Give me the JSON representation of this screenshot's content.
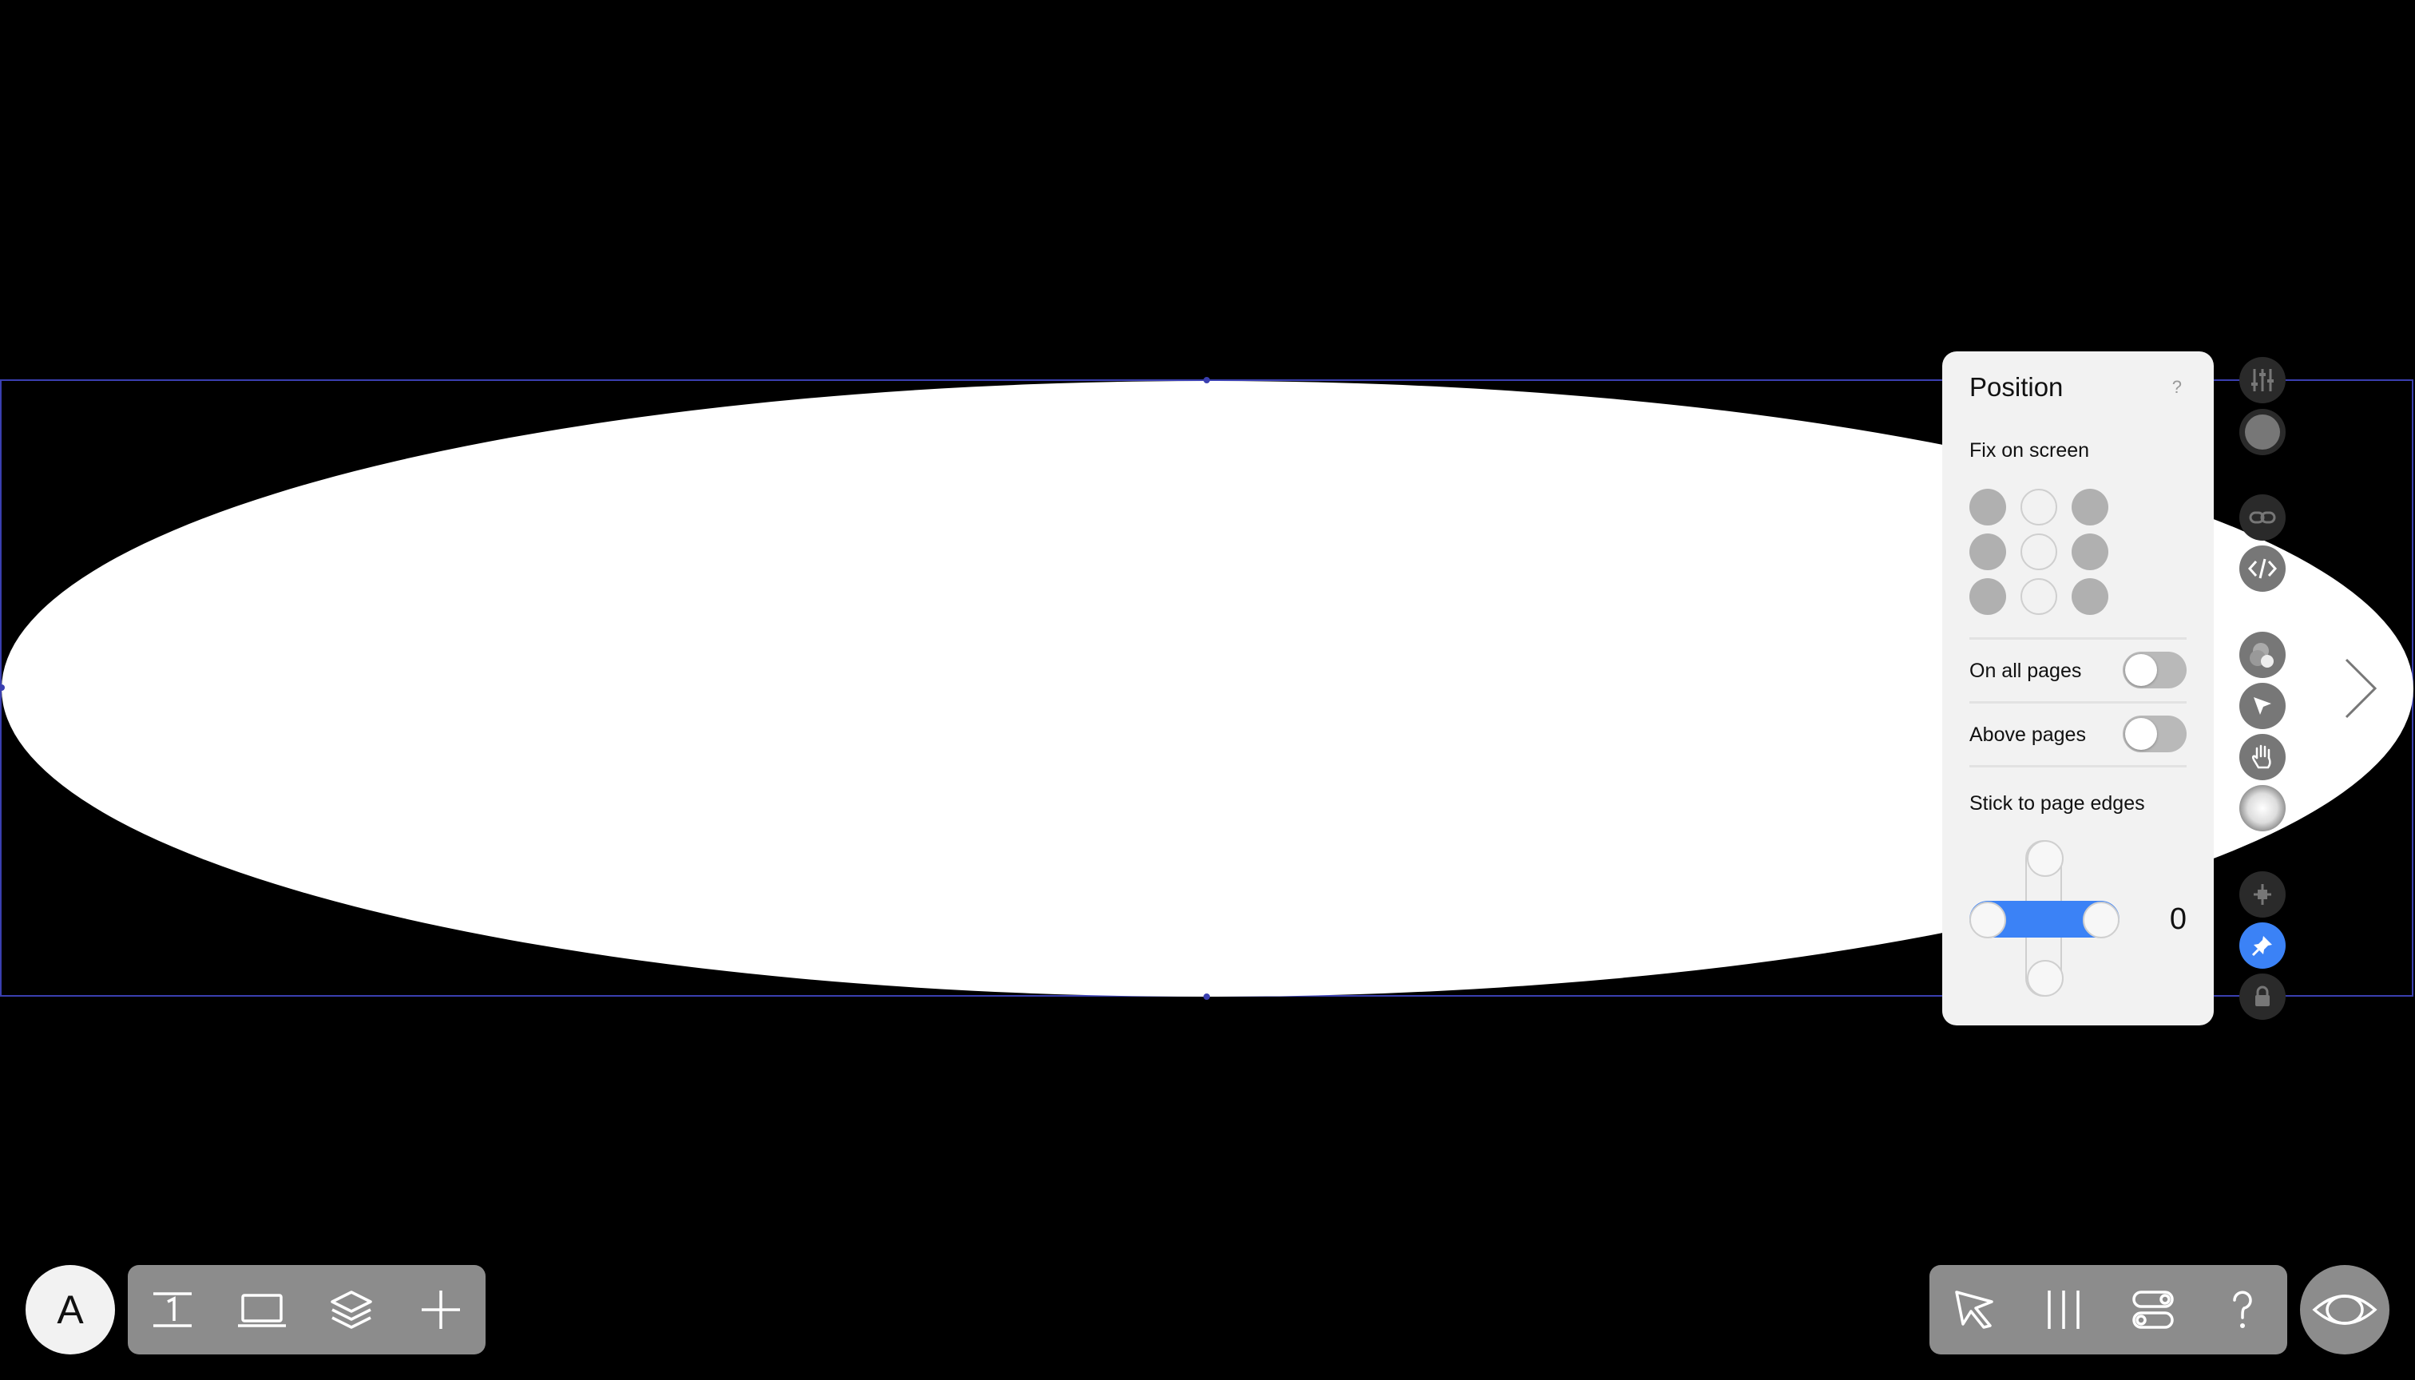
{
  "panel": {
    "title": "Position",
    "help": "?",
    "fix_on_screen": {
      "label": "Fix on screen",
      "anchors": [
        [
          "on",
          "off",
          "on"
        ],
        [
          "on",
          "off",
          "on"
        ],
        [
          "on",
          "off",
          "on"
        ]
      ]
    },
    "on_all_pages": {
      "label": "On all pages",
      "enabled": false
    },
    "above_pages": {
      "label": "Above pages",
      "enabled": false
    },
    "stick_to_edges": {
      "label": "Stick to page edges",
      "value": "0"
    }
  },
  "rail_icons": [
    "sliders-icon",
    "color-icon",
    "link-icon",
    "code-icon",
    "blend-icon",
    "cursor-icon",
    "hand-icon",
    "glow-icon",
    "crosshair-icon",
    "pin-icon",
    "lock-icon"
  ],
  "avatar": {
    "letter": "A"
  },
  "left_toolbar": [
    "page-number-icon",
    "device-icon",
    "layers-icon",
    "plus-icon"
  ],
  "right_toolbar": [
    "select-icon",
    "columns-icon",
    "toggles-icon",
    "help-icon"
  ],
  "colors": {
    "accent": "#3b82f6",
    "toolbar": "#8c8c8c",
    "panel": "#f2f2f2"
  }
}
